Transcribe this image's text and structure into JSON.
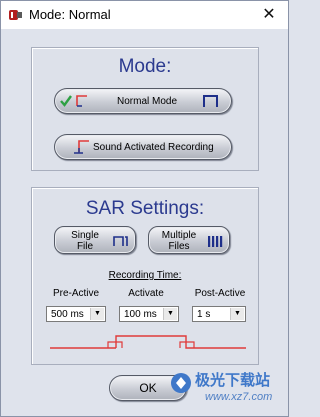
{
  "window": {
    "title": "Mode: Normal"
  },
  "mode_panel": {
    "title": "Mode:",
    "normal_mode_label": "Normal Mode",
    "sar_label": "Sound Activated Recording"
  },
  "sar_panel": {
    "title": "SAR Settings:",
    "single_file_label": "Single\nFile",
    "multiple_files_label": "Multiple\nFiles",
    "recording_time_label": "Recording Time:",
    "pre_active": {
      "label": "Pre-Active",
      "value": "500 ms"
    },
    "activate": {
      "label": "Activate",
      "value": "100 ms"
    },
    "post_active": {
      "label": "Post-Active",
      "value": "1 s"
    }
  },
  "ok_label": "OK",
  "watermark": {
    "cn": "极光下载站",
    "url": "www.xz7.com"
  },
  "colors": {
    "title_blue": "#2b3a8f",
    "signal_red": "#e03a3a",
    "check_green": "#2ea043"
  }
}
